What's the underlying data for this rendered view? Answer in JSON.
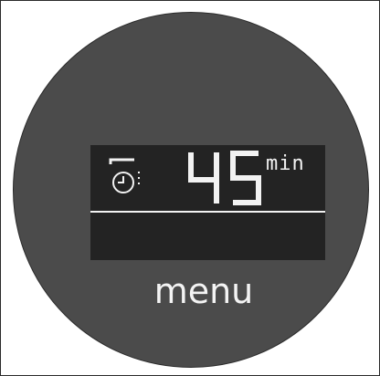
{
  "display": {
    "time_value": "45",
    "time_unit": "min",
    "mode_icon": "timer-clock-icon"
  },
  "controls": {
    "menu_label": "menu"
  },
  "colors": {
    "dial": "#4b4b4b",
    "display_background": "#232323",
    "segment": "#f2f2f2"
  }
}
